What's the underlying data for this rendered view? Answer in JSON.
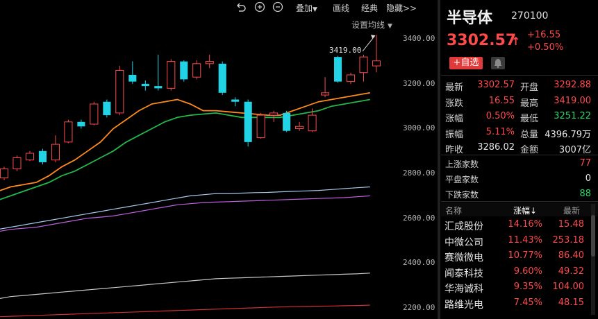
{
  "toolbar": {
    "overlay_label": "叠加",
    "draw_label": "画线",
    "classic_label": "经典",
    "hide_label": "隐藏>>"
  },
  "chart": {
    "ma_setting_label": "设置均线",
    "y_labels": [
      "3400.00",
      "3200.00",
      "3000.00",
      "2800.00",
      "2600.00",
      "2400.00",
      "2200.00"
    ],
    "max_label": "3419.00",
    "colors": {
      "up": "#ff4a4a",
      "down": "#22d3e6",
      "ma1": "#ff8a1a",
      "ma2": "#22b84a",
      "ma3": "#a8c8e8",
      "ma4": "#c060e0",
      "ma5": "#c8c8c8",
      "ma6": "#d03030"
    }
  },
  "chart_data": {
    "type": "candlestick",
    "y_axis_range": [
      2150,
      3500
    ],
    "max_marker": 3419.0,
    "candles": [
      {
        "o": 2780,
        "c": 2820,
        "h": 2830,
        "l": 2770
      },
      {
        "o": 2820,
        "c": 2870,
        "h": 2880,
        "l": 2810
      },
      {
        "o": 2860,
        "c": 2890,
        "h": 2900,
        "l": 2855
      },
      {
        "o": 2900,
        "c": 2850,
        "h": 2910,
        "l": 2840
      },
      {
        "o": 2860,
        "c": 2930,
        "h": 2970,
        "l": 2850
      },
      {
        "o": 2940,
        "c": 3030,
        "h": 3040,
        "l": 2935
      },
      {
        "o": 3030,
        "c": 3010,
        "h": 3040,
        "l": 3000
      },
      {
        "o": 3020,
        "c": 3110,
        "h": 3120,
        "l": 3015
      },
      {
        "o": 3120,
        "c": 3060,
        "h": 3130,
        "l": 3050
      },
      {
        "o": 3070,
        "c": 3260,
        "h": 3280,
        "l": 3060
      },
      {
        "o": 3240,
        "c": 3210,
        "h": 3300,
        "l": 3200
      },
      {
        "o": 3200,
        "c": 3190,
        "h": 3215,
        "l": 3170
      },
      {
        "o": 3190,
        "c": 3180,
        "h": 3330,
        "l": 3170
      },
      {
        "o": 3180,
        "c": 3300,
        "h": 3310,
        "l": 3170
      },
      {
        "o": 3300,
        "c": 3220,
        "h": 3305,
        "l": 3210
      },
      {
        "o": 3230,
        "c": 3290,
        "h": 3305,
        "l": 3220
      },
      {
        "o": 3290,
        "c": 3300,
        "h": 3330,
        "l": 3270
      },
      {
        "o": 3290,
        "c": 3160,
        "h": 3300,
        "l": 3150
      },
      {
        "o": 3130,
        "c": 3120,
        "h": 3140,
        "l": 3100
      },
      {
        "o": 3120,
        "c": 2940,
        "h": 3130,
        "l": 2920
      },
      {
        "o": 2960,
        "c": 3060,
        "h": 3070,
        "l": 2955
      },
      {
        "o": 3060,
        "c": 3070,
        "h": 3080,
        "l": 3030
      },
      {
        "o": 3070,
        "c": 2990,
        "h": 3080,
        "l": 2985
      },
      {
        "o": 3000,
        "c": 3010,
        "h": 3030,
        "l": 2990
      },
      {
        "o": 2990,
        "c": 3060,
        "h": 3090,
        "l": 2985
      },
      {
        "o": 3150,
        "c": 3160,
        "h": 3230,
        "l": 3140
      },
      {
        "o": 3320,
        "c": 3210,
        "h": 3325,
        "l": 3205
      },
      {
        "o": 3210,
        "c": 3240,
        "h": 3250,
        "l": 3200
      },
      {
        "o": 3250,
        "c": 3320,
        "h": 3330,
        "l": 3210
      },
      {
        "o": 3280,
        "c": 3302.57,
        "h": 3419,
        "l": 3251.22
      }
    ],
    "ma_lines": [
      {
        "color": "#ff8a1a",
        "points": [
          2720,
          2740,
          2750,
          2760,
          2790,
          2830,
          2860,
          2900,
          2940,
          3000,
          3040,
          3080,
          3110,
          3120,
          3130,
          3110,
          3080,
          3080,
          3075,
          3070,
          3065,
          3060,
          3060,
          3080,
          3100,
          3120,
          3130,
          3140,
          3150,
          3160
        ]
      },
      {
        "color": "#22b84a",
        "points": [
          2680,
          2700,
          2720,
          2740,
          2760,
          2790,
          2810,
          2840,
          2870,
          2900,
          2940,
          2970,
          3000,
          3030,
          3050,
          3060,
          3065,
          3070,
          3060,
          3050,
          3050,
          3050,
          3050,
          3060,
          3070,
          3080,
          3100,
          3110,
          3120,
          3130
        ]
      },
      {
        "color": "#a8c8e8",
        "points": [
          2550,
          2560,
          2570,
          2580,
          2590,
          2600,
          2610,
          2620,
          2630,
          2640,
          2650,
          2660,
          2670,
          2680,
          2690,
          2700,
          2705,
          2710,
          2710,
          2712,
          2714,
          2715,
          2718,
          2720,
          2722,
          2724,
          2728,
          2732,
          2736,
          2740
        ]
      },
      {
        "color": "#c060e0",
        "points": [
          2540,
          2550,
          2555,
          2560,
          2570,
          2580,
          2590,
          2600,
          2605,
          2610,
          2620,
          2630,
          2640,
          2650,
          2660,
          2665,
          2670,
          2672,
          2674,
          2676,
          2678,
          2680,
          2682,
          2684,
          2686,
          2688,
          2690,
          2692,
          2696,
          2700
        ]
      },
      {
        "color": "#c8c8c8",
        "points": [
          2240,
          2250,
          2255,
          2260,
          2265,
          2270,
          2275,
          2280,
          2285,
          2290,
          2295,
          2300,
          2305,
          2310,
          2315,
          2320,
          2325,
          2330,
          2332,
          2334,
          2336,
          2338,
          2340,
          2342,
          2344,
          2346,
          2348,
          2350,
          2352,
          2355
        ]
      },
      {
        "color": "#d03030",
        "points": [
          2160,
          2162,
          2164,
          2166,
          2168,
          2170,
          2172,
          2174,
          2176,
          2178,
          2180,
          2182,
          2184,
          2186,
          2188,
          2190,
          2192,
          2194,
          2196,
          2198,
          2200,
          2202,
          2204,
          2205,
          2206,
          2207,
          2208,
          2209,
          2210,
          2212
        ]
      }
    ]
  },
  "quote": {
    "name": "半导体",
    "code": "270100",
    "price": "3302.57",
    "arrow": "↑",
    "change": "+16.55",
    "change_pct": "+0.50%",
    "watch_label": "+自选",
    "rows": [
      {
        "l1": "最新",
        "v1": "3302.57",
        "c1": "red",
        "l2": "开盘",
        "v2": "3292.88",
        "c2": "red"
      },
      {
        "l1": "涨跌",
        "v1": "16.55",
        "c1": "red",
        "l2": "最高",
        "v2": "3419.00",
        "c2": "red"
      },
      {
        "l1": "涨幅",
        "v1": "0.50%",
        "c1": "red",
        "l2": "最低",
        "v2": "3251.22",
        "c2": "green"
      },
      {
        "l1": "振幅",
        "v1": "5.11%",
        "c1": "red",
        "l2": "总量",
        "v2": "4396.79万",
        "c2": "white"
      },
      {
        "l1": "昨收",
        "v1": "3286.02",
        "c1": "white",
        "l2": "金额",
        "v2": "3007亿",
        "c2": "white"
      }
    ],
    "counts": [
      {
        "label": "上涨家数",
        "value": "77",
        "color": "red"
      },
      {
        "label": "平盘家数",
        "value": "0",
        "color": "white"
      },
      {
        "label": "下跌家数",
        "value": "88",
        "color": "green"
      }
    ]
  },
  "list": {
    "headers": {
      "name": "名称",
      "pct": "涨幅↓",
      "price": "最新"
    },
    "rows": [
      {
        "name": "汇成股份",
        "pct": "14.16%",
        "price": "15.48"
      },
      {
        "name": "中微公司",
        "pct": "11.43%",
        "price": "253.18"
      },
      {
        "name": "赛微微电",
        "pct": "10.77%",
        "price": "86.40"
      },
      {
        "name": "闻泰科技",
        "pct": "9.60%",
        "price": "49.32"
      },
      {
        "name": "华海诚科",
        "pct": "9.35%",
        "price": "104.00"
      },
      {
        "name": "路维光电",
        "pct": "7.45%",
        "price": "48.15"
      }
    ]
  }
}
